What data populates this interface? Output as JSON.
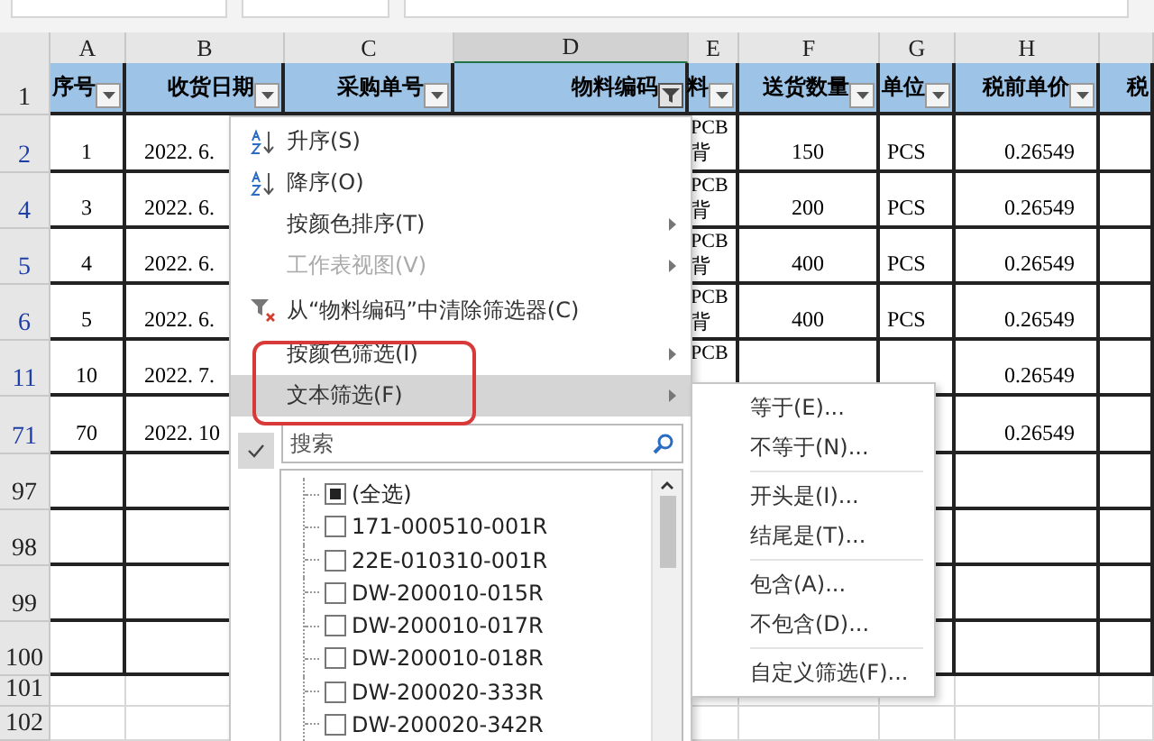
{
  "columns": [
    {
      "letter": "A",
      "selected": false
    },
    {
      "letter": "B",
      "selected": false
    },
    {
      "letter": "C",
      "selected": false
    },
    {
      "letter": "D",
      "selected": true
    },
    {
      "letter": "E",
      "selected": false
    },
    {
      "letter": "F",
      "selected": false
    },
    {
      "letter": "G",
      "selected": false
    },
    {
      "letter": "H",
      "selected": false
    }
  ],
  "header_row": {
    "number": "1",
    "cells": [
      {
        "text": "序号",
        "filtered": false
      },
      {
        "text": "收货日期",
        "filtered": false
      },
      {
        "text": "采购单号",
        "filtered": false
      },
      {
        "text": "物料编码",
        "filtered": true
      },
      {
        "text": "料",
        "filtered": false
      },
      {
        "text": "送货数量",
        "filtered": false
      },
      {
        "text": "单位",
        "filtered": false
      },
      {
        "text": "税前单价",
        "filtered": false
      },
      {
        "text": "税"
      }
    ]
  },
  "rows": [
    {
      "number": "2",
      "filtered": true,
      "seq": "1",
      "date": "2022. 6.",
      "desc": [
        "PCB",
        "背"
      ],
      "qty": "150",
      "unit": "PCS",
      "price": "0.26549"
    },
    {
      "number": "4",
      "filtered": true,
      "seq": "3",
      "date": "2022. 6.",
      "desc": [
        "PCB",
        "背"
      ],
      "qty": "200",
      "unit": "PCS",
      "price": "0.26549"
    },
    {
      "number": "5",
      "filtered": true,
      "seq": "4",
      "date": "2022. 6.",
      "desc": [
        "PCB",
        "背"
      ],
      "qty": "400",
      "unit": "PCS",
      "price": "0.26549"
    },
    {
      "number": "6",
      "filtered": true,
      "seq": "5",
      "date": "2022. 6.",
      "desc": [
        "PCB",
        "背"
      ],
      "qty": "400",
      "unit": "PCS",
      "price": "0.26549"
    },
    {
      "number": "11",
      "filtered": true,
      "seq": "10",
      "date": "2022. 7.",
      "desc": [
        "PCB"
      ],
      "price": "0.26549"
    },
    {
      "number": "71",
      "filtered": true,
      "seq": "70",
      "date": "2022. 10",
      "desc": [],
      "price": "0.26549"
    },
    {
      "number": "97",
      "filtered": false,
      "desc": []
    },
    {
      "number": "98",
      "filtered": false,
      "desc": []
    },
    {
      "number": "99",
      "filtered": false,
      "desc": []
    },
    {
      "number": "100",
      "filtered": false,
      "desc": []
    },
    {
      "number": "101",
      "filtered": false,
      "desc": []
    },
    {
      "number": "102",
      "filtered": false,
      "desc": []
    }
  ],
  "filter_menu": {
    "items": [
      {
        "label": "升序(S)",
        "kind": "ascending",
        "disabled": false,
        "submenu": false,
        "selected": false
      },
      {
        "label": "降序(O)",
        "kind": "descending",
        "disabled": false,
        "submenu": false,
        "selected": false
      },
      {
        "label": "按颜色排序(T)",
        "kind": "plain",
        "disabled": false,
        "submenu": true,
        "selected": false
      },
      {
        "label": "工作表视图(V)",
        "kind": "plain",
        "disabled": true,
        "submenu": true,
        "selected": false
      },
      {
        "label": "从“物料编码”中清除筛选器(C)",
        "kind": "clear",
        "disabled": false,
        "submenu": false,
        "selected": false
      },
      {
        "label": "按颜色筛选(I)",
        "kind": "plain",
        "disabled": false,
        "submenu": true,
        "selected": false
      },
      {
        "label": "文本筛选(F)",
        "kind": "plain",
        "disabled": false,
        "submenu": true,
        "selected": true
      }
    ],
    "search": {
      "placeholder": "搜索"
    },
    "values": [
      {
        "label": "(全选)",
        "checked": false,
        "partial": true
      },
      {
        "label": "171-000510-001R",
        "checked": false,
        "partial": false
      },
      {
        "label": "22E-010310-001R",
        "checked": false,
        "partial": false
      },
      {
        "label": "DW-200010-015R",
        "checked": false,
        "partial": false
      },
      {
        "label": "DW-200010-017R",
        "checked": false,
        "partial": false
      },
      {
        "label": "DW-200010-018R",
        "checked": false,
        "partial": false
      },
      {
        "label": "DW-200020-333R",
        "checked": false,
        "partial": false
      },
      {
        "label": "DW-200020-342R",
        "checked": false,
        "partial": false
      }
    ]
  },
  "text_filter_menu": {
    "groups": [
      [
        "等于(E)...",
        "不等于(N)..."
      ],
      [
        "开头是(I)...",
        "结尾是(T)..."
      ],
      [
        "包含(A)...",
        "不包含(D)..."
      ],
      [
        "自定义筛选(F)..."
      ]
    ]
  }
}
